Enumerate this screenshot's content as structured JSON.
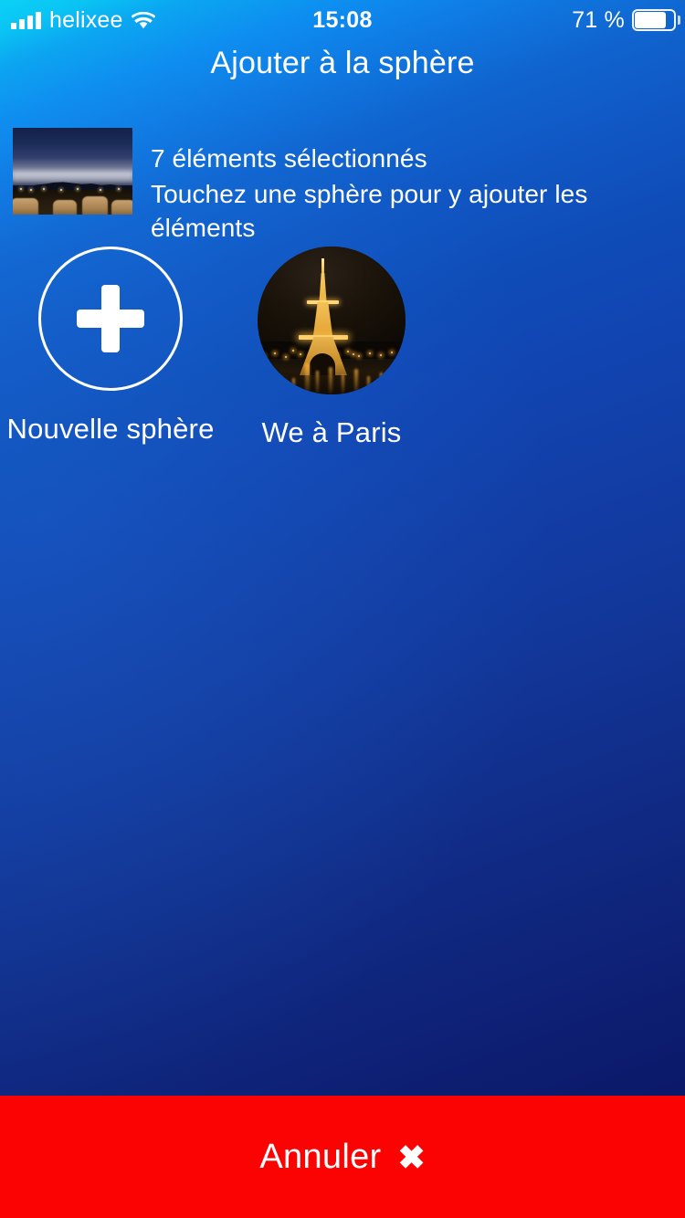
{
  "status_bar": {
    "signal_icon": "signal-bars-icon",
    "carrier": "helixee",
    "wifi_icon": "wifi-icon",
    "time": "15:08",
    "battery_percent": "71 %",
    "battery_icon": "battery-icon",
    "battery_level": 71
  },
  "header": {
    "title": "Ajouter à la sphère"
  },
  "selection": {
    "thumbnail_name": "selected-media-thumbnail",
    "count_text": "7 éléments sélectionnés",
    "hint_text": "Touchez une sphère pour y ajouter les éléments"
  },
  "spheres": [
    {
      "id": "new-sphere",
      "label": "Nouvelle sphère",
      "icon": "plus-icon",
      "kind": "new"
    },
    {
      "id": "we-a-paris",
      "label": "We à Paris",
      "icon": "eiffel-tower-photo",
      "kind": "photo"
    }
  ],
  "footer": {
    "cancel_label": "Annuler",
    "cancel_icon": "close-x-icon",
    "cancel_glyph": "✖"
  },
  "colors": {
    "gradient_top": "#0ad4f7",
    "gradient_mid": "#0f4cb8",
    "gradient_bottom": "#0a1360",
    "cancel_red": "#fb0303",
    "text": "#ffffff"
  }
}
